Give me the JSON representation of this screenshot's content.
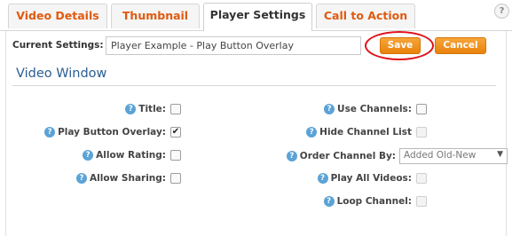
{
  "tabs": [
    {
      "label": "Video Details",
      "active": false
    },
    {
      "label": "Thumbnail",
      "active": false
    },
    {
      "label": "Player Settings",
      "active": true
    },
    {
      "label": "Call to Action",
      "active": false
    }
  ],
  "help_icon_glyph": "?",
  "current_settings": {
    "label": "Current Settings:",
    "value": "Player Example - Play Button Overlay"
  },
  "buttons": {
    "save": "Save",
    "cancel": "Cancel"
  },
  "section_title": "Video Window",
  "left_options": [
    {
      "label": "Title:",
      "checked": false
    },
    {
      "label": "Play Button Overlay:",
      "checked": true
    },
    {
      "label": "Allow Rating:",
      "checked": false
    },
    {
      "label": "Allow Sharing:",
      "checked": false
    }
  ],
  "right_options": [
    {
      "label": "Use Channels:",
      "checked": false,
      "disabled": false
    },
    {
      "label": "Hide Channel List",
      "checked": false,
      "disabled": true
    },
    {
      "label": "Order Channel By:",
      "select_value": "Added Old-New"
    },
    {
      "label": "Play All Videos:",
      "checked": false,
      "disabled": true
    },
    {
      "label": "Loop Channel:",
      "checked": false,
      "disabled": true
    }
  ],
  "colors": {
    "tab_text": "#e05a10",
    "accent_button": "#f39a2a",
    "highlight_ring": "#e0101a",
    "section_title": "#2a5e92",
    "help_icon": "#5ba3d6"
  }
}
